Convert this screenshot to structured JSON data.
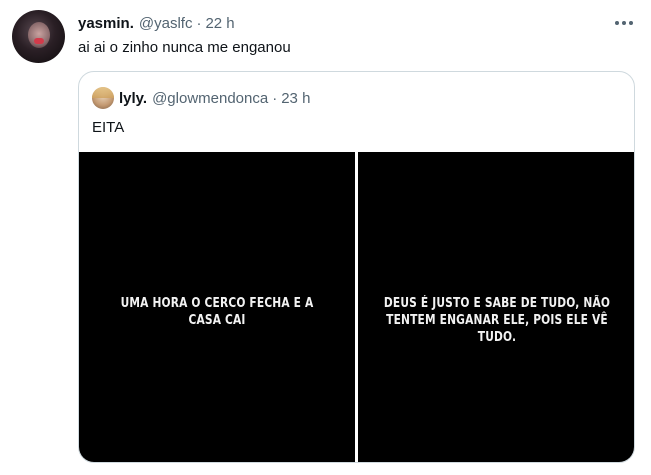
{
  "tweet": {
    "display_name": "yasmin.",
    "handle": "@yaslfc",
    "separator": "·",
    "time": "22 h",
    "text": "ai ai o zinho nunca me enganou"
  },
  "quoted_tweet": {
    "display_name": "lyly.",
    "handle": "@glowmendonca",
    "separator": "·",
    "time": "23 h",
    "text": "EITA",
    "images": [
      {
        "caption": "UMA HORA O CERCO FECHA E A CASA CAI"
      },
      {
        "caption": "DEUS É JUSTO E SABE DE TUDO, NÃO TENTEM ENGANAR ELE, POIS ELE VÊ TUDO."
      }
    ]
  },
  "icons": {
    "more": "more-horizontal-icon"
  },
  "colors": {
    "text_primary": "#0f1419",
    "text_secondary": "#536471",
    "border": "#cfd9de",
    "image_background": "#000000"
  }
}
